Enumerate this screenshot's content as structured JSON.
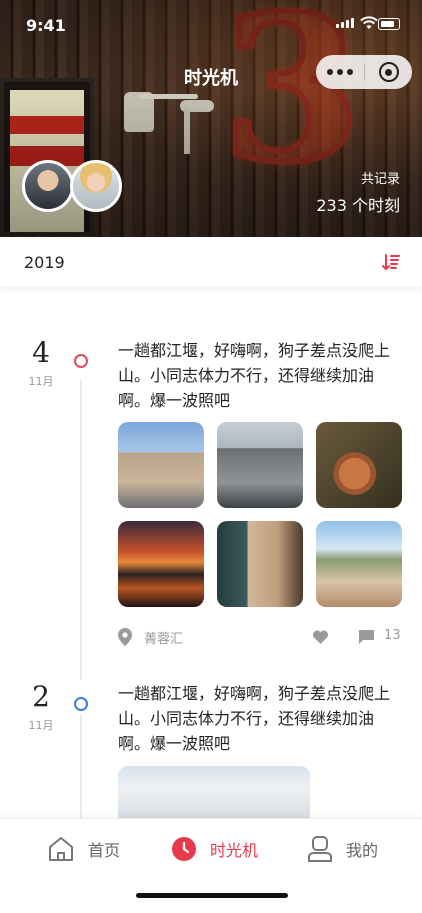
{
  "status_bar": {
    "time": "9:41"
  },
  "header": {
    "title": "时光机",
    "record_label": "共记录",
    "record_total": "233 个时刻"
  },
  "year_bar": {
    "year": "2019"
  },
  "entries": [
    {
      "day": "4",
      "month": "11月",
      "text": "一趟都江堰，好嗨啊，狗子差点没爬上山。小同志体力不行，还得继续加油啊。爆一波照吧",
      "location": "菁蓉汇",
      "comment_count": "13",
      "dot_color": "#e04a5a",
      "photo_count": 6
    },
    {
      "day": "2",
      "month": "11月",
      "text": "一趟都江堰，好嗨啊，狗子差点没爬上山。小同志体力不行，还得继续加油啊。爆一波照吧",
      "dot_color": "#3a7fd5"
    }
  ],
  "tabbar": {
    "items": [
      {
        "label": "首页",
        "icon": "home-icon"
      },
      {
        "label": "时光机",
        "icon": "clock-icon",
        "active": true
      },
      {
        "label": "我的",
        "icon": "profile-icon"
      }
    ]
  },
  "colors": {
    "accent": "#e83a4c",
    "blue_dot": "#3a7fd5"
  }
}
